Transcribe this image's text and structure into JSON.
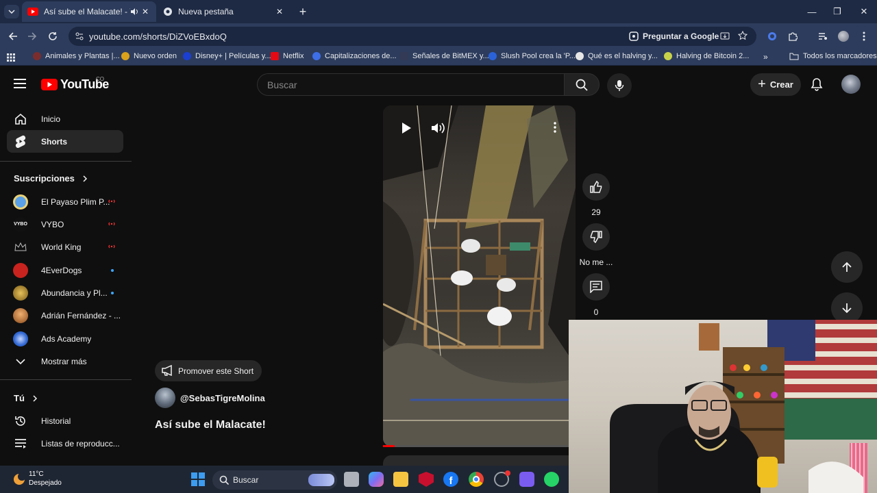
{
  "browser": {
    "tabs": [
      {
        "title": "Así sube el Malacate! - YouTube",
        "active": true
      },
      {
        "title": "Nueva pestaña",
        "active": false
      }
    ],
    "url": "youtube.com/shorts/DiZVoEBxdoQ",
    "google_button": "Preguntar a Google",
    "bookmarks": [
      {
        "label": "Animales y Plantas |...",
        "color": "#7a2d2d"
      },
      {
        "label": "Nuevo orden",
        "color": "#d9a21a"
      },
      {
        "label": "Disney+ | Películas y...",
        "color": "#1b3fd1"
      },
      {
        "label": "Netflix",
        "color": "#e50914"
      },
      {
        "label": "Capitalizaciones de...",
        "color": "#3e6ee8"
      },
      {
        "label": "Señales de BitMEX y...",
        "color": "#333a55"
      },
      {
        "label": "Slush Pool crea la 'P...",
        "color": "#2a62d9"
      },
      {
        "label": "Qué es el halving y...",
        "color": "#e6e6e6"
      },
      {
        "label": "Halving de Bitcoin 2...",
        "color": "#c9d34a"
      }
    ],
    "all_bookmarks": "Todos los marcadores"
  },
  "youtube": {
    "logo_text": "YouTube",
    "country_code": "CO",
    "search_placeholder": "Buscar",
    "create_label": "Crear",
    "sidebar": {
      "main": [
        {
          "label": "Inicio",
          "icon": "home-icon",
          "selected": false
        },
        {
          "label": "Shorts",
          "icon": "shorts-icon",
          "selected": true
        }
      ],
      "subscriptions_title": "Suscripciones",
      "subscriptions": [
        {
          "label": "El Payaso Plim P...",
          "indicator": "live",
          "color": "#5aa1e8"
        },
        {
          "label": "VYBO",
          "indicator": "live",
          "color": "#111111"
        },
        {
          "label": "World King",
          "indicator": "live",
          "color": "#222222"
        },
        {
          "label": "4EverDogs",
          "indicator": "new",
          "color": "#c8231e"
        },
        {
          "label": "Abundancia y Pl...",
          "indicator": "new",
          "color": "#b58b2a"
        },
        {
          "label": "Adrián Fernández - ...",
          "indicator": "none",
          "color": "#d07a2a"
        },
        {
          "label": "Ads Academy",
          "indicator": "none",
          "color": "#2f66d1"
        }
      ],
      "show_more": "Mostrar más",
      "you_title": "Tú",
      "you_items": [
        {
          "label": "Historial",
          "icon": "history-icon"
        },
        {
          "label": "Listas de reproducc...",
          "icon": "playlist-icon"
        }
      ]
    },
    "short": {
      "promote_label": "Promover este Short",
      "channel": "@SebasTigreMolina",
      "title": "Así sube el Malacate!",
      "progress": 0.06
    },
    "actions": {
      "likes": "29",
      "dislike_label": "No me ...",
      "comments": "0"
    }
  },
  "taskbar": {
    "temperature": "11°C",
    "weather": "Despejado",
    "search_label": "Buscar",
    "apps": [
      {
        "icon": "start-icon",
        "color": "#3d9cf0"
      },
      {
        "icon": "task-view-icon",
        "color": "#cfd4dc"
      },
      {
        "icon": "copilot-icon",
        "color": "#7f6df2"
      },
      {
        "icon": "file-explorer-icon",
        "color": "#f5c542"
      },
      {
        "icon": "mcafee-icon",
        "color": "#c8102e"
      },
      {
        "icon": "facebook-icon",
        "color": "#1877f2"
      },
      {
        "icon": "chrome-icon",
        "color": "#34a853"
      },
      {
        "icon": "system-app-icon",
        "color": "#9aa0a6"
      },
      {
        "icon": "teams-icon",
        "color": "#7b5cf0"
      },
      {
        "icon": "whatsapp-icon",
        "color": "#25d366"
      }
    ]
  }
}
